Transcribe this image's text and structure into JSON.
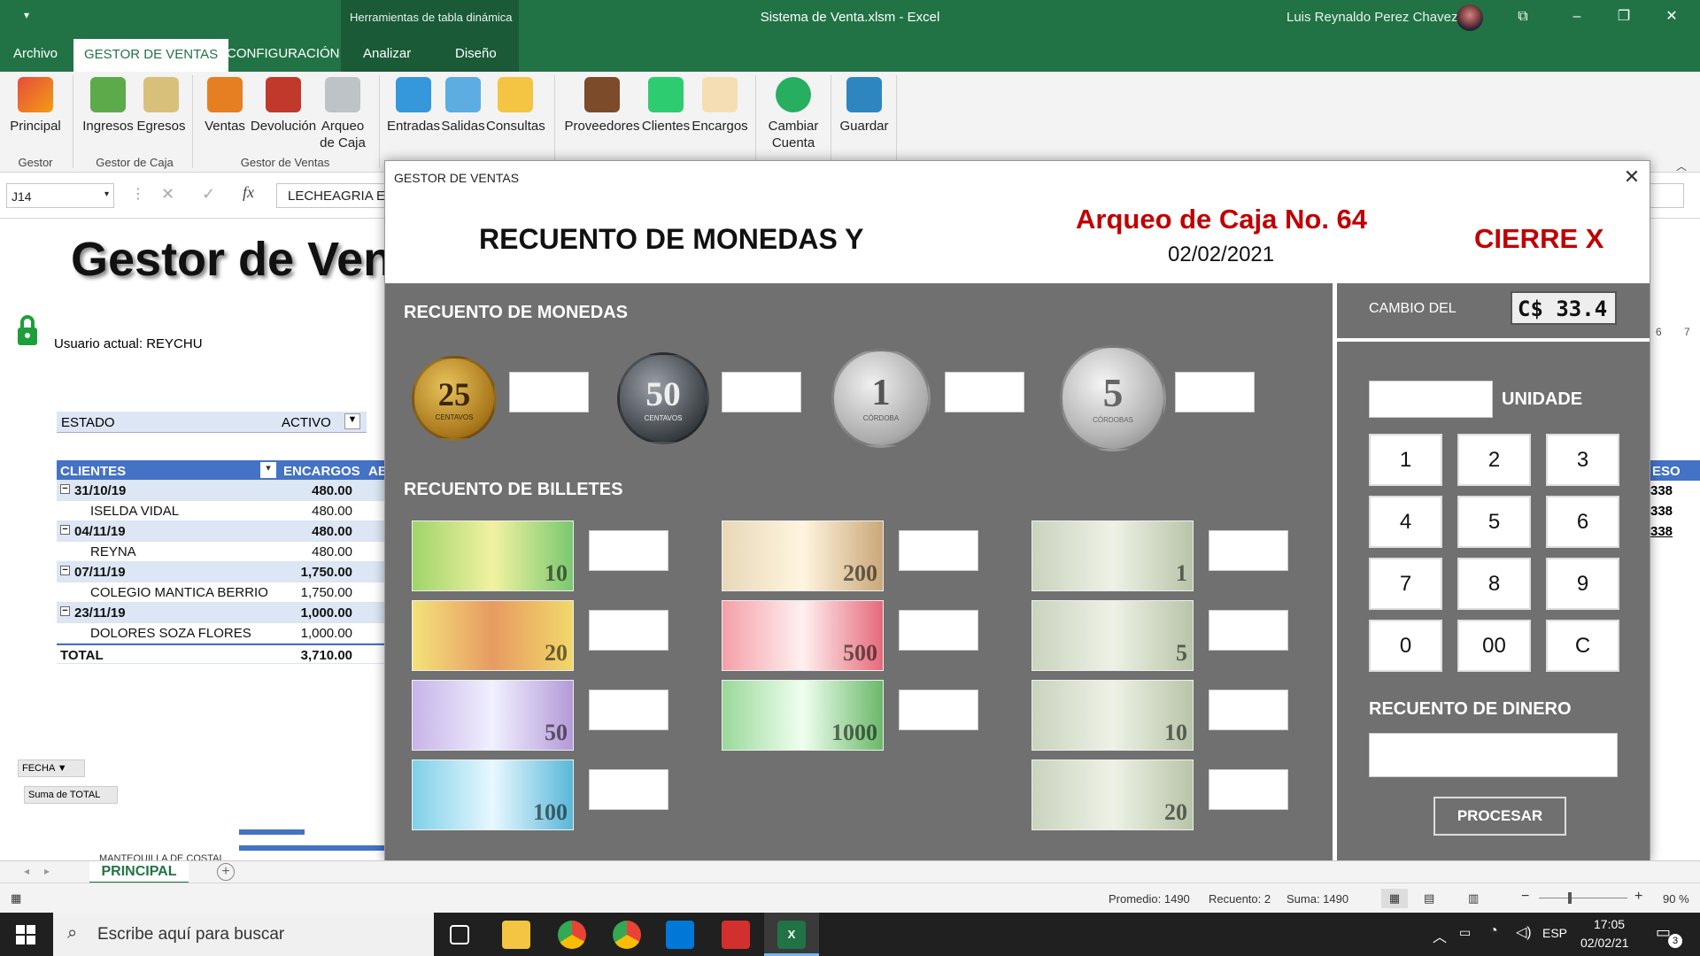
{
  "titlebar": {
    "context_tab": "Herramientas de tabla dinámica",
    "title": "Sistema de Venta.xlsm  -  Excel",
    "user": "Luis Reynaldo Perez Chavez"
  },
  "tabs": [
    "Archivo",
    "GESTOR DE VENTAS",
    "CONFIGURACIÓN",
    "Analizar",
    "Diseño"
  ],
  "ribbon": {
    "buttons": [
      "Principal",
      "Ingresos",
      "Egresos",
      "Ventas",
      "Devolución",
      "Arqueo de Caja",
      "Entradas",
      "Salidas",
      "Consultas",
      "Proveedores",
      "Clientes",
      "Encargos",
      "Cambiar Cuenta",
      "Guardar"
    ],
    "groups": [
      "Gestor",
      "Gestor de Caja",
      "Gestor de Ventas"
    ]
  },
  "formula_bar": {
    "name_box": "J14",
    "formula": "LECHEAGRIA EN"
  },
  "sheet": {
    "title": "Gestor de Ven",
    "user_label": "Usuario actual: REYCHU",
    "filter": {
      "label": "ESTADO",
      "value": "ACTIVO"
    },
    "pivot": {
      "headers": [
        "CLIENTES",
        "ENCARGOS",
        "AB"
      ],
      "rows": [
        {
          "label": "31/10/19",
          "value": "480.00",
          "type": "date"
        },
        {
          "label": "ISELDA VIDAL",
          "value": "480.00",
          "type": "item"
        },
        {
          "label": "04/11/19",
          "value": "480.00",
          "type": "date"
        },
        {
          "label": "REYNA",
          "value": "480.00",
          "type": "item"
        },
        {
          "label": "07/11/19",
          "value": "1,750.00",
          "type": "date"
        },
        {
          "label": "COLEGIO MANTICA BERRIO",
          "value": "1,750.00",
          "type": "item"
        },
        {
          "label": "23/11/19",
          "value": "1,000.00",
          "type": "date"
        },
        {
          "label": "DOLORES SOZA FLORES",
          "value": "1,000.00",
          "type": "item"
        },
        {
          "label": "TOTAL",
          "value": "3,710.00",
          "type": "total"
        }
      ]
    },
    "chart_filter": "FECHA",
    "chart_sum": "Suma de TOTAL",
    "chart_label": "MANTEQUILLA DE COSTAL",
    "right_partial": [
      "6",
      "7",
      "ESO",
      "338",
      "338",
      "338"
    ]
  },
  "dialog": {
    "window_title": "GESTOR DE VENTAS",
    "heading": "RECUENTO DE MONEDAS Y",
    "arqueo": "Arqueo de Caja  No. 64",
    "date": "02/02/2021",
    "cierre": "CIERRE X",
    "coins_title": "RECUENTO DE MONEDAS",
    "bills_title": "RECUENTO DE BILLETES",
    "coins": [
      "25",
      "50",
      "1",
      "5"
    ],
    "coin_sub": [
      "CENTAVOS",
      "CENTAVOS",
      "CÓRDOBA",
      "CÓRDOBAS"
    ],
    "bills_nio_left": [
      "10",
      "20",
      "50",
      "100"
    ],
    "bills_nio_mid": [
      "200",
      "500",
      "1000"
    ],
    "bills_usd": [
      "1",
      "5",
      "10",
      "20"
    ],
    "cambio_label": "CAMBIO DEL",
    "cambio_value": "C$   33.4",
    "unidad_label": "UNIDADE",
    "keys": [
      "1",
      "2",
      "3",
      "4",
      "5",
      "6",
      "7",
      "8",
      "9",
      "0",
      "00",
      "C"
    ],
    "recuento_label": "RECUENTO DE DINERO",
    "procesar": "PROCESAR"
  },
  "sheet_tab": "PRINCIPAL",
  "status": {
    "promedio": "Promedio: 1490",
    "recuento": "Recuento: 2",
    "suma": "Suma: 1490",
    "zoom": "90 %"
  },
  "taskbar": {
    "search": "Escribe aquí para buscar",
    "lang": "ESP",
    "time": "17:05",
    "date": "02/02/21",
    "notif": "3"
  }
}
